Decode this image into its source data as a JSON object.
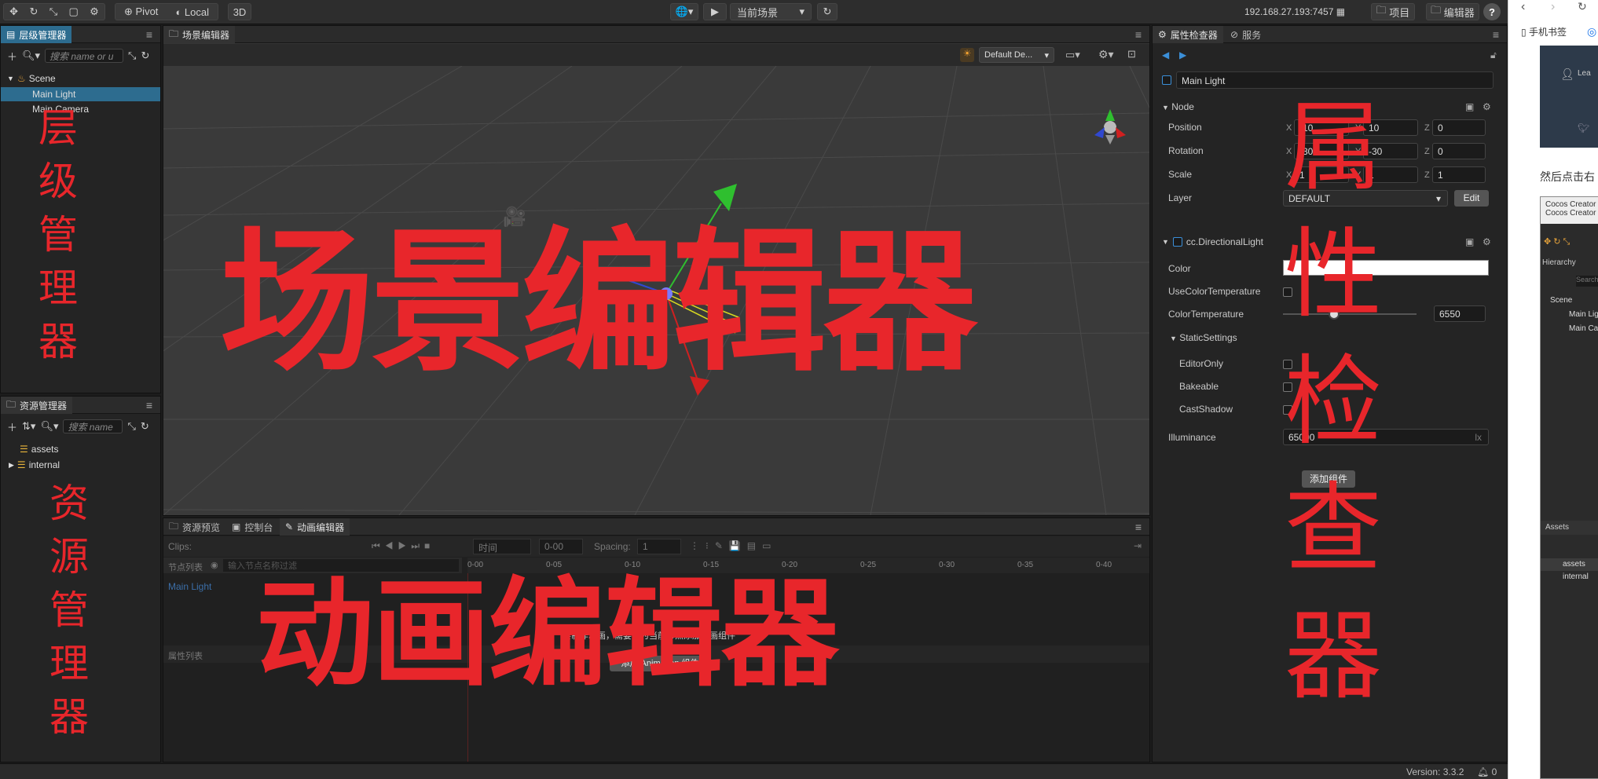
{
  "toolbar": {
    "pivot": "Pivot",
    "local": "Local",
    "mode3d": "3D",
    "scene_select": "当前场景",
    "ip": "192.168.27.193:7457",
    "project": "项目",
    "editor": "编辑器",
    "help": "?"
  },
  "hierarchy": {
    "title": "层级管理器",
    "search_placeholder": "搜索 name or u",
    "root": "Scene",
    "items": [
      "Main Light",
      "Main Camera"
    ],
    "annotation": [
      "层",
      "级",
      "管",
      "理",
      "器"
    ]
  },
  "assets": {
    "title": "资源管理器",
    "search_placeholder": "搜索 name",
    "items": [
      "assets",
      "internal"
    ],
    "annotation": [
      "资",
      "源",
      "管",
      "理",
      "器"
    ]
  },
  "scene": {
    "title": "场景编辑器",
    "camera_select": "Default De...",
    "annotation": "场景编辑器"
  },
  "bottom": {
    "tabs": [
      "资源预览",
      "控制台",
      "动画编辑器"
    ],
    "clips_label": "Clips:",
    "time_label": "时间",
    "time_value": "0-00",
    "spacing_label": "Spacing:",
    "spacing_value": "1",
    "node_list_label": "节点列表",
    "node_filter_placeholder": "输入节点名称过滤",
    "node_item": "Main Light",
    "prop_list_label": "属性列表",
    "curve_label": "Curve",
    "ticks": [
      "0-00",
      "0-05",
      "0-10",
      "0-15",
      "0-20",
      "0-25",
      "0-30",
      "0-35",
      "0-40"
    ],
    "message": "要制作动画，需要先为当前节点添加动画组件",
    "add_button": "添加 Animation 组件",
    "annotation": "动画编辑器"
  },
  "inspector": {
    "tabs": [
      "属性检查器",
      "服务"
    ],
    "node_name": "Main Light",
    "node_section": "Node",
    "position_label": "Position",
    "position": [
      "-10",
      "10",
      "0"
    ],
    "rotation_label": "Rotation",
    "rotation": [
      "-30",
      "-30",
      "0"
    ],
    "scale_label": "Scale",
    "scale": [
      "1",
      "1",
      "1"
    ],
    "layer_label": "Layer",
    "layer_value": "DEFAULT",
    "edit_button": "Edit",
    "component": "cc.DirectionalLight",
    "color_label": "Color",
    "use_color_temp_label": "UseColorTemperature",
    "color_temp_label": "ColorTemperature",
    "color_temp_value": "6550",
    "color_temp_slider_level": 0.38,
    "static_settings": "StaticSettings",
    "editor_only": "EditorOnly",
    "bakeable": "Bakeable",
    "cast_shadow": "CastShadow",
    "illuminance_label": "Illuminance",
    "illuminance_value": "65000",
    "illuminance_unit": "lx",
    "add_component": "添加组件",
    "annotation": [
      "属",
      "性",
      "检",
      "查",
      "器"
    ]
  },
  "statusbar": {
    "version": "Version: 3.3.2",
    "notifications": "0"
  },
  "browser": {
    "bookmark": "手机书签",
    "then_text": "然后点击右",
    "cocos_title": "Cocos Creator",
    "cocos_sub": "Cocos Creator 3",
    "hierarchy": "Hierarchy",
    "search": "Search",
    "scene": "Scene",
    "main_light": "Main Lig",
    "main_camera": "Main Ca",
    "assets_title": "Assets",
    "assets": "assets",
    "internal": "internal",
    "lea": "Lea"
  }
}
